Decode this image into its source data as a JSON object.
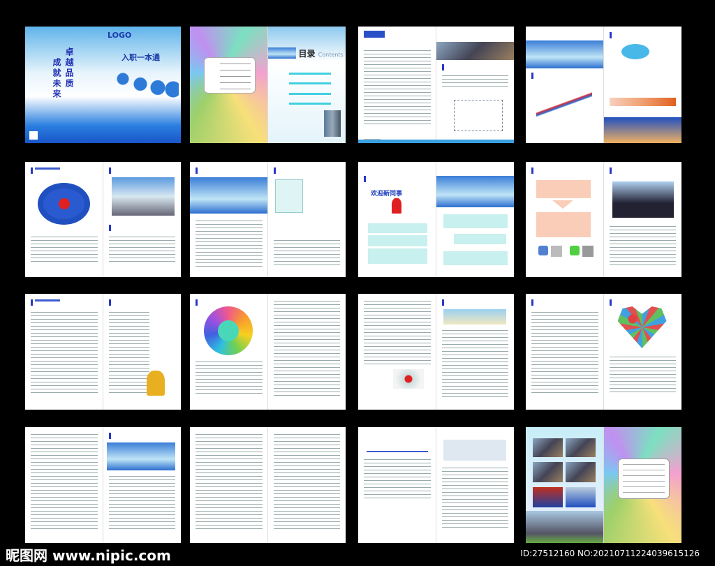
{
  "cover": {
    "logo": "LOGO",
    "title": "入职一本通",
    "slogan_right": "卓越品质",
    "slogan_left": "成就未来"
  },
  "contents": {
    "title": "目录",
    "subtitle": "Contents"
  },
  "welcome_page": {
    "heading": "欢迎新同事"
  },
  "watermark": {
    "site": "昵图网 www.nipic.com",
    "id": "ID:27512160 NO:20210711224039615126"
  },
  "colors": {
    "accent": "#2838c8",
    "background": "#000000",
    "cyan": "#3fd0e0"
  }
}
